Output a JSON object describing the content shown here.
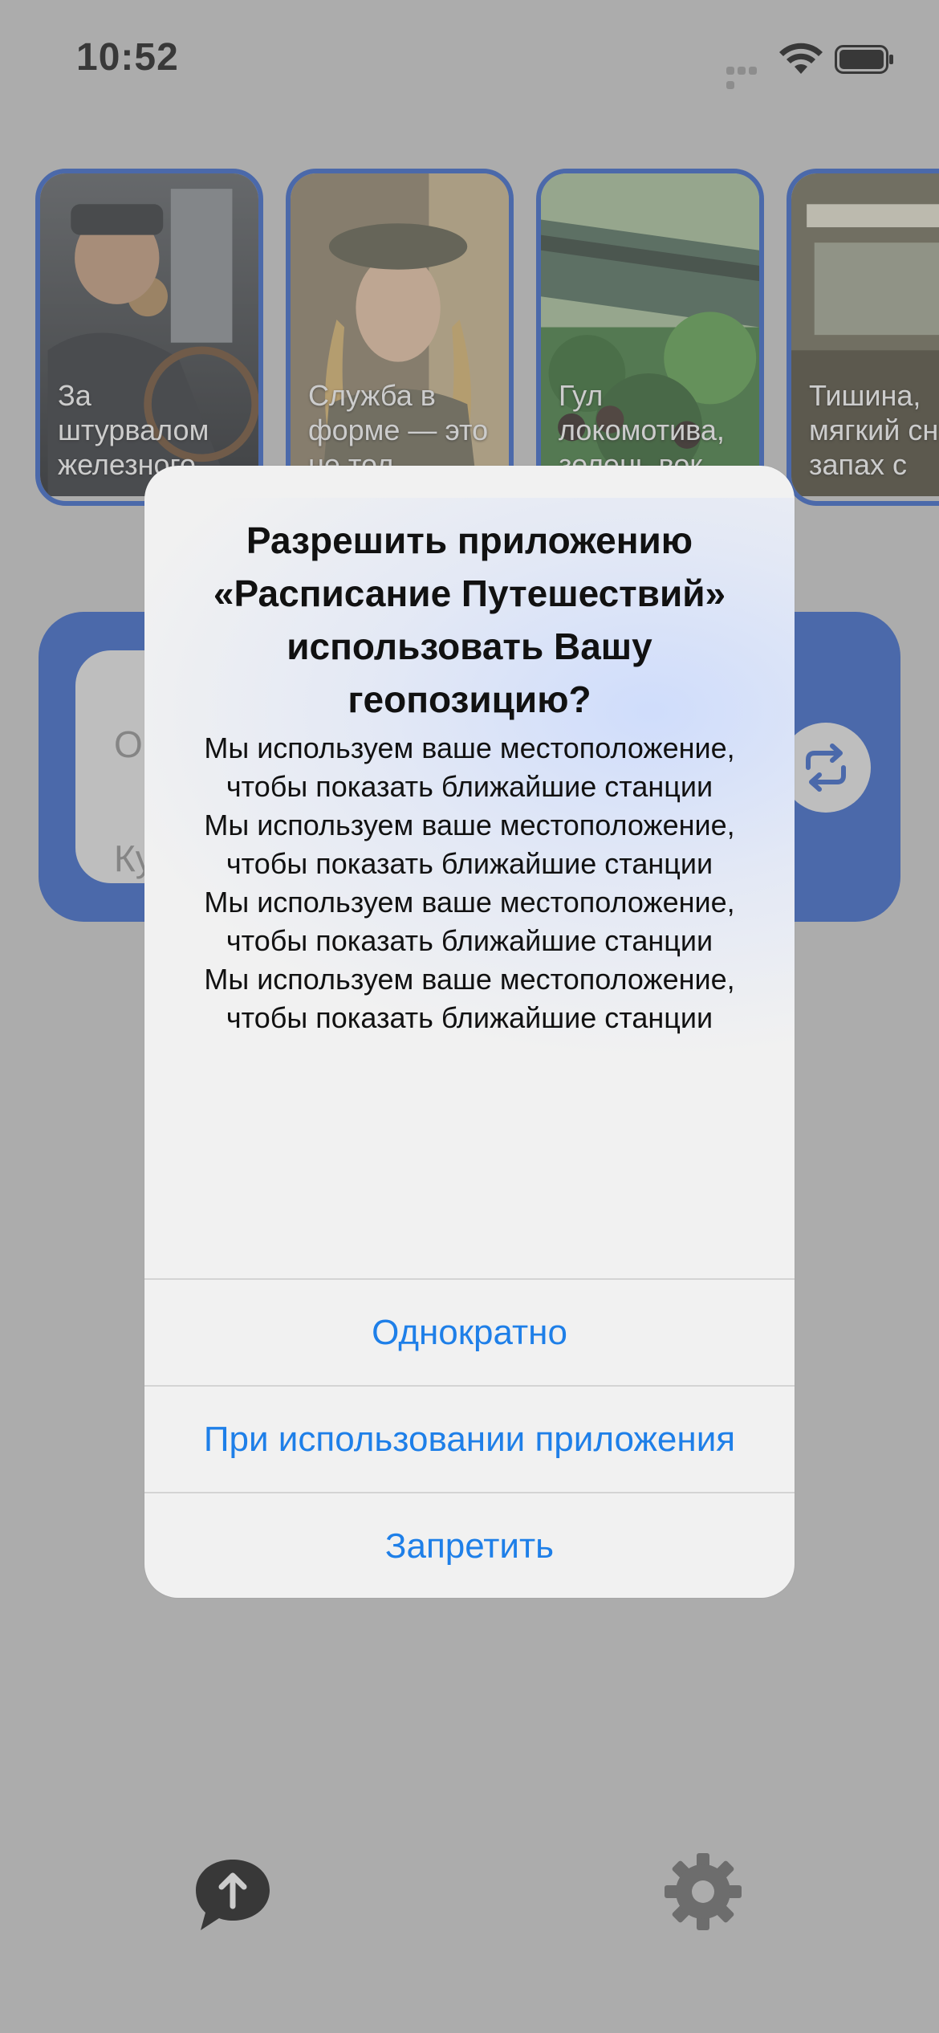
{
  "status_bar": {
    "time": "10:52"
  },
  "stories": [
    {
      "text": "За штурвалом железного",
      "icon": "train-driver-art"
    },
    {
      "text": "Служба в форме — это не тол",
      "icon": "conductor-art"
    },
    {
      "text": "Гул локомотива, зелень вок",
      "icon": "jungle-train-art"
    },
    {
      "text": "Тишина, мягкий сн и запах с",
      "icon": "carriage-interior-art"
    }
  ],
  "route_card": {
    "from_placeholder": "О",
    "to_placeholder": "Ку",
    "swap_icon": "swap-arrows-icon"
  },
  "alert": {
    "title": "Разрешить приложению «Расписание Путешествий» использовать Вашу геопозицию?",
    "messages": [
      "Мы используем ваше местоположение, чтобы показать ближайшие станции",
      "Мы используем ваше местоположение, чтобы показать ближайшие станции",
      "Мы используем ваше местоположение, чтобы показать ближайшие станции",
      "Мы используем ваше местоположение, чтобы показать ближайшие станции"
    ],
    "buttons": {
      "once": "Однократно",
      "while_using": "При использовании приложения",
      "deny": "Запретить"
    },
    "button_color": "#1e7fe8"
  },
  "toolbar": {
    "share_icon": "upload-bubble-icon",
    "settings_icon": "gear-icon"
  },
  "colors": {
    "accent": "#2f5fc8",
    "background": "#cccccc"
  }
}
